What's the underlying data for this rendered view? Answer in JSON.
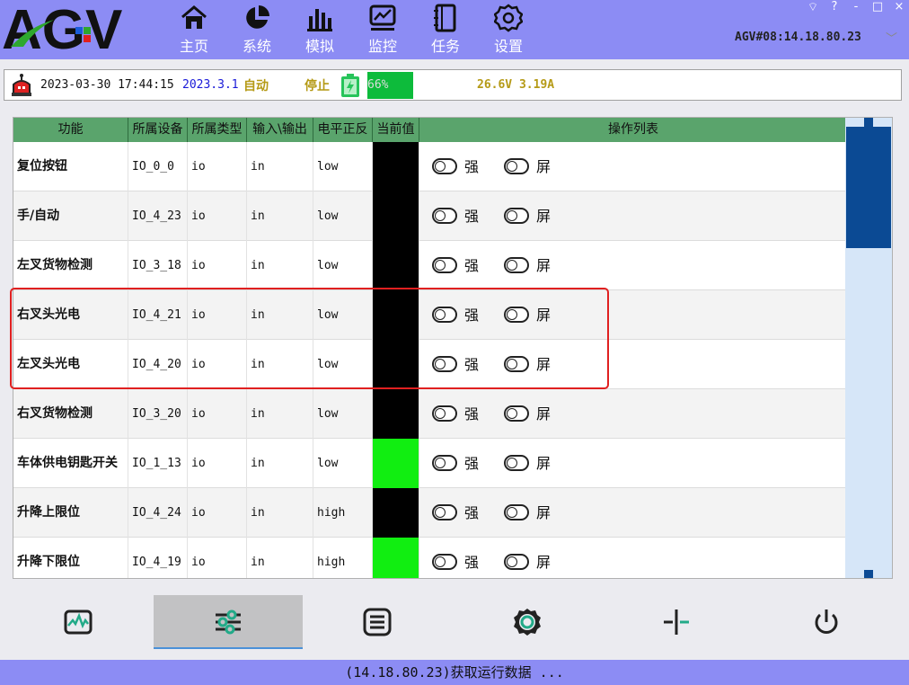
{
  "header": {
    "logo_text": "AGV",
    "nav": [
      {
        "label": "主页",
        "icon": "home-icon"
      },
      {
        "label": "系统",
        "icon": "pie-chart-icon"
      },
      {
        "label": "模拟",
        "icon": "bar-chart-icon"
      },
      {
        "label": "监控",
        "icon": "monitor-chart-icon"
      },
      {
        "label": "任务",
        "icon": "notebook-icon"
      },
      {
        "label": "设置",
        "icon": "gear-icon"
      }
    ],
    "window_controls": [
      "?",
      "-",
      "□",
      "×"
    ],
    "host": "AGV#08:14.18.80.23"
  },
  "status": {
    "datetime": "2023-03-30 17:44:15",
    "version": "2023.3.1",
    "mode": "自动",
    "run_state": "停止",
    "battery_percent_text": "66%",
    "battery_level": 0.66,
    "power": "26.6V 3.19A"
  },
  "table": {
    "headers": [
      "功能",
      "所属设备",
      "所属类型",
      "输入\\输出",
      "电平正反",
      "当前值",
      "操作列表"
    ],
    "op_force": "强制",
    "op_mask": "屏蔽",
    "rows": [
      {
        "func": "复位按钮",
        "device": "IO_0_0",
        "type": "io",
        "dir": "in",
        "level": "low",
        "value": "black"
      },
      {
        "func": "手/自动",
        "device": "IO_4_23",
        "type": "io",
        "dir": "in",
        "level": "low",
        "value": "black"
      },
      {
        "func": "左叉货物检测",
        "device": "IO_3_18",
        "type": "io",
        "dir": "in",
        "level": "low",
        "value": "black"
      },
      {
        "func": "右叉头光电",
        "device": "IO_4_21",
        "type": "io",
        "dir": "in",
        "level": "low",
        "value": "black"
      },
      {
        "func": "左叉头光电",
        "device": "IO_4_20",
        "type": "io",
        "dir": "in",
        "level": "low",
        "value": "black"
      },
      {
        "func": "右叉货物检测",
        "device": "IO_3_20",
        "type": "io",
        "dir": "in",
        "level": "low",
        "value": "black"
      },
      {
        "func": "车体供电钥匙开关",
        "device": "IO_1_13",
        "type": "io",
        "dir": "in",
        "level": "low",
        "value": "green"
      },
      {
        "func": "升降上限位",
        "device": "IO_4_24",
        "type": "io",
        "dir": "in",
        "level": "high",
        "value": "black"
      },
      {
        "func": "升降下限位",
        "device": "IO_4_19",
        "type": "io",
        "dir": "in",
        "level": "high",
        "value": "green"
      }
    ]
  },
  "colors": {
    "value_black": "#000000",
    "value_green": "#11ee11",
    "accent": "#8c8cf4",
    "header_green": "#5aa46c"
  },
  "toolbar": {
    "buttons": [
      {
        "icon": "waveform-icon",
        "active": false
      },
      {
        "icon": "sliders-icon",
        "active": true
      },
      {
        "icon": "list-icon",
        "active": false
      },
      {
        "icon": "gear-ring-icon",
        "active": false
      },
      {
        "icon": "crosshair-icon",
        "active": false
      },
      {
        "icon": "power-icon",
        "active": false
      }
    ]
  },
  "footer": {
    "message": "(14.18.80.23)获取运行数据 ..."
  }
}
